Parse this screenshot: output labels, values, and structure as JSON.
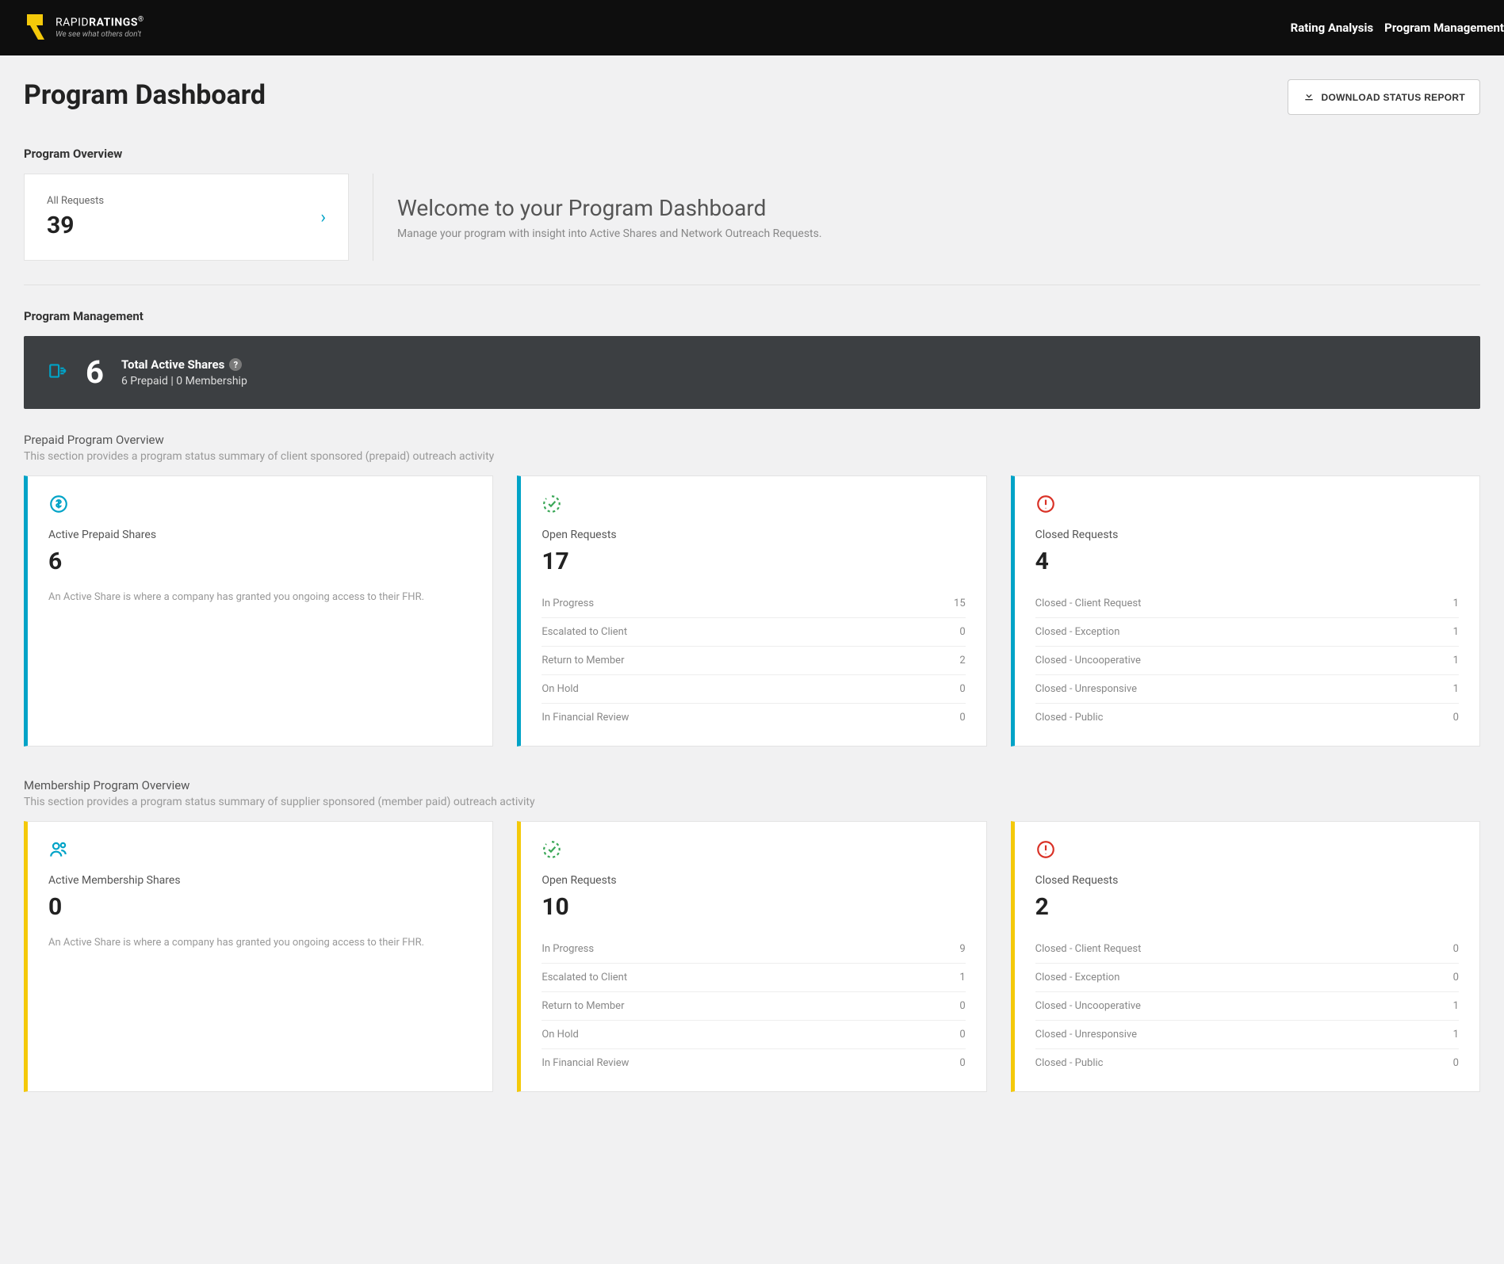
{
  "header": {
    "logo_regular": "RAPID",
    "logo_bold": "RATINGS",
    "logo_reg_mark": "®",
    "logo_tagline": "We see what others don't",
    "nav": {
      "rating_analysis": "Rating Analysis",
      "program_management": "Program Management"
    }
  },
  "page": {
    "title": "Program Dashboard",
    "download_label": "DOWNLOAD STATUS REPORT"
  },
  "program_overview": {
    "heading": "Program Overview",
    "all_requests_label": "All Requests",
    "all_requests_value": "39",
    "welcome_title": "Welcome to your Program Dashboard",
    "welcome_sub": "Manage your program with insight into Active Shares and Network Outreach Requests."
  },
  "program_management": {
    "heading": "Program Management",
    "total_value": "6",
    "total_label": "Total Active Shares",
    "breakdown": "6 Prepaid | 0 Membership"
  },
  "prepaid": {
    "title": "Prepaid Program Overview",
    "desc": "This section provides a program status summary of client sponsored (prepaid) outreach activity",
    "active": {
      "label": "Active Prepaid Shares",
      "value": "6",
      "desc": "An Active Share is where a company has granted you ongoing access to their FHR."
    },
    "open": {
      "label": "Open Requests",
      "value": "17",
      "rows": [
        {
          "label": "In Progress",
          "count": "15"
        },
        {
          "label": "Escalated to Client",
          "count": "0"
        },
        {
          "label": "Return to Member",
          "count": "2"
        },
        {
          "label": "On Hold",
          "count": "0"
        },
        {
          "label": "In Financial Review",
          "count": "0"
        }
      ]
    },
    "closed": {
      "label": "Closed Requests",
      "value": "4",
      "rows": [
        {
          "label": "Closed - Client Request",
          "count": "1"
        },
        {
          "label": "Closed - Exception",
          "count": "1"
        },
        {
          "label": "Closed - Uncooperative",
          "count": "1"
        },
        {
          "label": "Closed - Unresponsive",
          "count": "1"
        },
        {
          "label": "Closed - Public",
          "count": "0"
        }
      ]
    }
  },
  "membership": {
    "title": "Membership Program Overview",
    "desc": "This section provides a program status summary of supplier sponsored (member paid) outreach activity",
    "active": {
      "label": "Active Membership Shares",
      "value": "0",
      "desc": "An Active Share is where a company has granted you ongoing access to their FHR."
    },
    "open": {
      "label": "Open Requests",
      "value": "10",
      "rows": [
        {
          "label": "In Progress",
          "count": "9"
        },
        {
          "label": "Escalated to Client",
          "count": "1"
        },
        {
          "label": "Return to Member",
          "count": "0"
        },
        {
          "label": "On Hold",
          "count": "0"
        },
        {
          "label": "In Financial Review",
          "count": "0"
        }
      ]
    },
    "closed": {
      "label": "Closed Requests",
      "value": "2",
      "rows": [
        {
          "label": "Closed - Client Request",
          "count": "0"
        },
        {
          "label": "Closed - Exception",
          "count": "0"
        },
        {
          "label": "Closed - Uncooperative",
          "count": "1"
        },
        {
          "label": "Closed - Unresponsive",
          "count": "1"
        },
        {
          "label": "Closed - Public",
          "count": "0"
        }
      ]
    }
  }
}
